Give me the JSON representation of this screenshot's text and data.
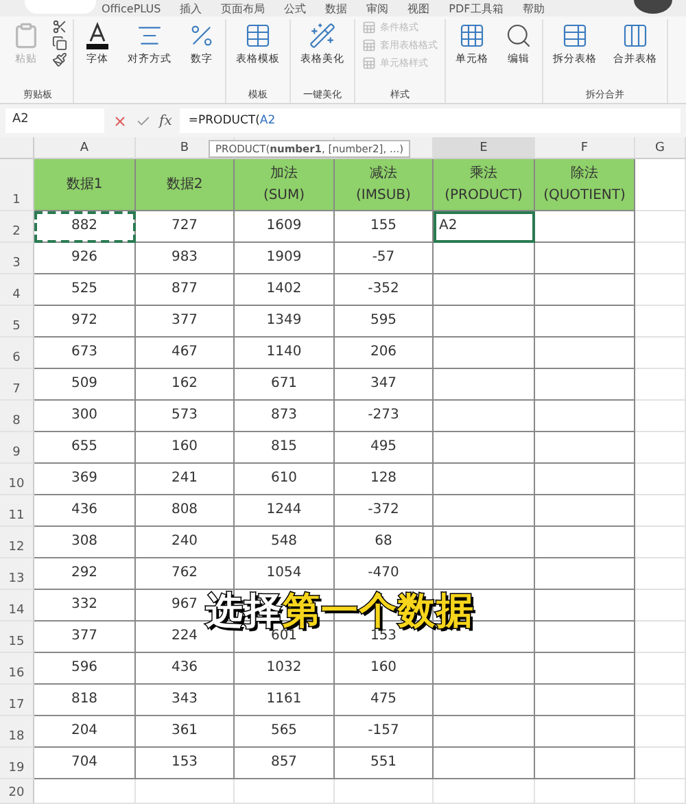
{
  "ribbon": {
    "tabs": [
      {
        "label": "OfficePLUS"
      },
      {
        "label": "插入"
      },
      {
        "label": "页面布局"
      },
      {
        "label": "公式"
      },
      {
        "label": "数据"
      },
      {
        "label": "审阅"
      },
      {
        "label": "视图"
      },
      {
        "label": "PDF工具箱"
      },
      {
        "label": "帮助"
      }
    ],
    "groups": [
      {
        "label": "剪贴板",
        "kind": "clipboard",
        "items": [
          {
            "label": "粘贴",
            "disabled": true
          }
        ]
      },
      {
        "kind": "plain",
        "items": [
          {
            "label": "字体",
            "disabled": false
          },
          {
            "label": "对齐方式",
            "disabled": false
          },
          {
            "label": "数字",
            "disabled": false
          }
        ]
      },
      {
        "label": "模板",
        "kind": "plain",
        "items": [
          {
            "label": "表格模板",
            "disabled": false
          }
        ]
      },
      {
        "label": "一键美化",
        "kind": "plain",
        "items": [
          {
            "label": "表格美化",
            "disabled": false
          }
        ]
      },
      {
        "label": "样式",
        "kind": "stack",
        "items": [
          {
            "label": "条件格式",
            "disabled": true
          },
          {
            "label": "套用表格格式",
            "disabled": true
          },
          {
            "label": "单元格样式",
            "disabled": true
          }
        ]
      },
      {
        "kind": "plain",
        "items": [
          {
            "label": "单元格",
            "disabled": false
          },
          {
            "label": "编辑",
            "disabled": false
          }
        ]
      },
      {
        "label": "拆分合并",
        "kind": "plain",
        "items": [
          {
            "label": "拆分表格",
            "disabled": false
          },
          {
            "label": "合并表格",
            "disabled": false
          }
        ]
      }
    ]
  },
  "formula_bar": {
    "name_box": "A2",
    "function_label": "fx",
    "formula": "=PRODUCT(A2",
    "tooltip": "PRODUCT(**number1**, [number2], ...)"
  },
  "sheet": {
    "columns": [
      {
        "label": "A",
        "selected": false
      },
      {
        "label": "B",
        "selected": false
      },
      {
        "selected": false
      },
      {
        "selected": false
      },
      {
        "label": "E",
        "selected": true
      },
      {
        "label": "F",
        "selected": false
      },
      {
        "label": "G",
        "selected": false
      }
    ],
    "header": {
      "number": "1",
      "cells": [
        "数据1",
        "数据2",
        "加法\n(SUM)",
        "减法\n(IMSUB)",
        "乘法\n(PRODUCT)",
        "除法\n(QUOTIENT)"
      ]
    },
    "rows": [
      {
        "number": "2",
        "cells": [
          {
            "text": "882",
            "copied": true,
            "editing": false
          },
          {
            "text": "727",
            "copied": false,
            "editing": false
          },
          {
            "text": "1609",
            "copied": false,
            "editing": false
          },
          {
            "text": "155",
            "copied": false,
            "editing": false
          },
          {
            "text": "A2",
            "copied": false,
            "editing": true
          },
          {
            "text": "",
            "copied": false,
            "editing": false
          }
        ]
      },
      {
        "number": "3",
        "cells": [
          "926",
          "983",
          "1909",
          "-57",
          "",
          ""
        ]
      },
      {
        "number": "4",
        "cells": [
          "525",
          "877",
          "1402",
          "-352",
          "",
          ""
        ]
      },
      {
        "number": "5",
        "cells": [
          "972",
          "377",
          "1349",
          "595",
          "",
          ""
        ]
      },
      {
        "number": "6",
        "cells": [
          "673",
          "467",
          "1140",
          "206",
          "",
          ""
        ]
      },
      {
        "number": "7",
        "cells": [
          "509",
          "162",
          "671",
          "347",
          "",
          ""
        ]
      },
      {
        "number": "8",
        "cells": [
          "300",
          "573",
          "873",
          "-273",
          "",
          ""
        ]
      },
      {
        "number": "9",
        "cells": [
          "655",
          "160",
          "815",
          "495",
          "",
          ""
        ]
      },
      {
        "number": "10",
        "cells": [
          "369",
          "241",
          "610",
          "128",
          "",
          ""
        ]
      },
      {
        "number": "11",
        "cells": [
          "436",
          "808",
          "1244",
          "-372",
          "",
          ""
        ]
      },
      {
        "number": "12",
        "cells": [
          "308",
          "240",
          "548",
          "68",
          "",
          ""
        ]
      },
      {
        "number": "13",
        "cells": [
          "292",
          "762",
          "1054",
          "-470",
          "",
          ""
        ]
      },
      {
        "number": "14",
        "cells": [
          "332",
          "967",
          "",
          "",
          "",
          ""
        ]
      },
      {
        "number": "15",
        "cells": [
          "377",
          "224",
          "601",
          "153",
          "",
          ""
        ]
      },
      {
        "number": "16",
        "cells": [
          "596",
          "436",
          "1032",
          "160",
          "",
          ""
        ]
      },
      {
        "number": "17",
        "cells": [
          "818",
          "343",
          "1161",
          "475",
          "",
          ""
        ]
      },
      {
        "number": "18",
        "cells": [
          "204",
          "361",
          "565",
          "-157",
          "",
          ""
        ]
      },
      {
        "number": "19",
        "cells": [
          "704",
          "153",
          "857",
          "551",
          "",
          ""
        ]
      }
    ],
    "empty_rows": [
      "20"
    ]
  },
  "caption": {
    "parts": [
      {
        "text": "选择",
        "color": "#ffffff"
      },
      {
        "text": "第一个数据",
        "color": "#f6d51c"
      }
    ]
  }
}
